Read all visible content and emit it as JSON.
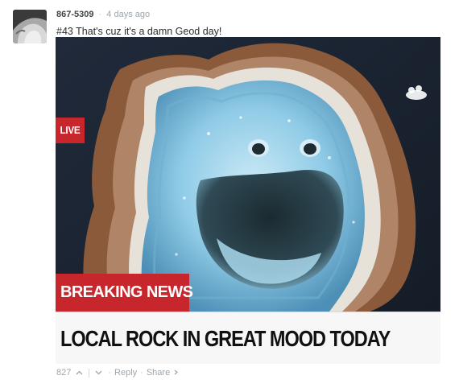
{
  "comment": {
    "username": "867-5309",
    "separator": "·",
    "timestamp": "4 days ago",
    "message": "#43 That's cuz it's a damn Geod day!"
  },
  "media": {
    "live_label": "LIVE",
    "breaking_label": "BREAKING NEWS",
    "headline": "LOCAL ROCK IN GREAT MOOD TODAY",
    "colors": {
      "news_red": "#c7272c",
      "headline_bg": "#f7f7f7",
      "geode_blue": "#7fc6e6",
      "rock_brown": "#8a5a3b"
    }
  },
  "footer": {
    "vote_count": "827",
    "upvote_icon": "chevron-up-icon",
    "downvote_icon": "chevron-down-icon",
    "dot": "·",
    "reply_label": "Reply",
    "share_label": "Share",
    "share_icon": "chevron-right-icon"
  }
}
